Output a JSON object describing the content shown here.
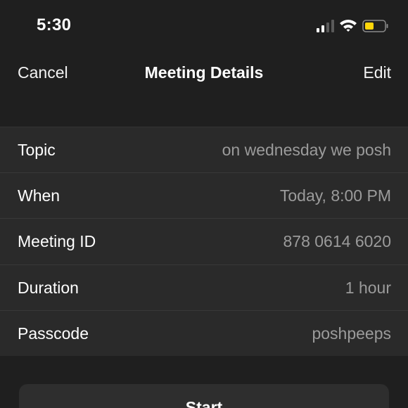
{
  "status_bar": {
    "time": "5:30",
    "signal_icon": "cellular-signal-icon",
    "wifi_icon": "wifi-icon",
    "battery_icon": "battery-icon",
    "battery_color": "#ffd60a"
  },
  "nav": {
    "cancel_label": "Cancel",
    "title": "Meeting Details",
    "edit_label": "Edit"
  },
  "details": [
    {
      "label": "Topic",
      "value": "on wednesday we posh"
    },
    {
      "label": "When",
      "value": "Today, 8:00 PM"
    },
    {
      "label": "Meeting ID",
      "value": "878 0614 6020"
    },
    {
      "label": "Duration",
      "value": "1 hour"
    },
    {
      "label": "Passcode",
      "value": "poshpeeps"
    }
  ],
  "start_button": {
    "label": "Start"
  }
}
